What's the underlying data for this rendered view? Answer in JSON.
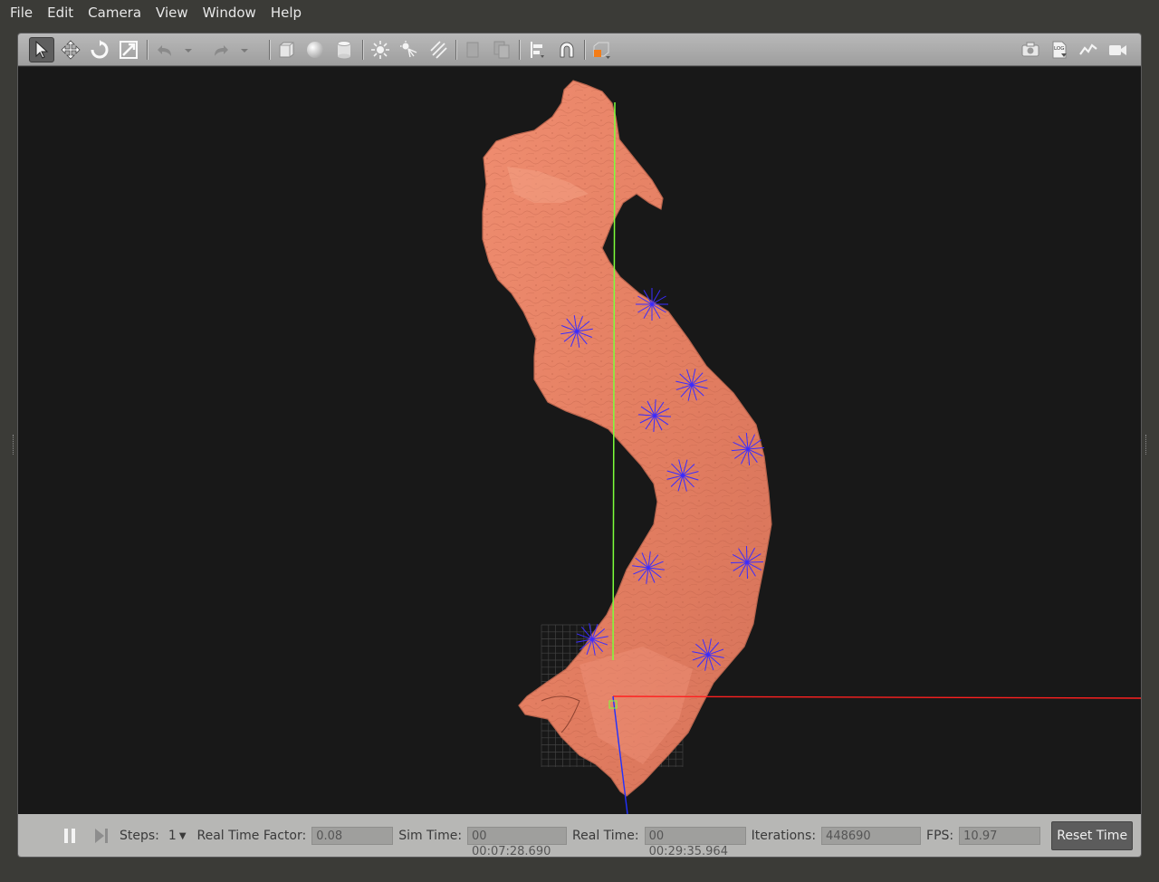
{
  "menu": [
    "File",
    "Edit",
    "Camera",
    "View",
    "Window",
    "Help"
  ],
  "toolbar": {
    "left_tools": [
      "select-arrow-icon",
      "translate-icon",
      "rotate-icon",
      "scale-icon",
      "undo-icon",
      "undo-history-icon",
      "redo-icon",
      "redo-history-icon",
      "box-shape-icon",
      "sphere-shape-icon",
      "cylinder-shape-icon",
      "point-light-icon",
      "spot-light-icon",
      "directional-light-icon",
      "copy-icon",
      "paste-icon",
      "align-icon",
      "snap-magnet-icon",
      "view-angle-icon"
    ],
    "right_tools": [
      "screenshot-camera-icon",
      "log-icon",
      "plot-icon",
      "video-record-icon"
    ],
    "log_text": "LOG"
  },
  "bottom": {
    "steps_label": "Steps:",
    "steps_value": "1",
    "rtf_label": "Real Time Factor:",
    "rtf_value": "0.08",
    "sim_time_label": "Sim Time:",
    "sim_time_value": "00 00:07:28.690",
    "real_time_label": "Real Time:",
    "real_time_value": "00 00:29:35.964",
    "iterations_label": "Iterations:",
    "iterations_value": "448690",
    "fps_label": "FPS:",
    "fps_value": "10.97",
    "reset_label": "Reset Time"
  },
  "colors": {
    "mesh": "#e9866a",
    "x_axis": "#ff2020",
    "y_axis": "#7cff3a",
    "z_axis": "#2030ff",
    "marker": "#3a2cff",
    "background": "#181818"
  }
}
